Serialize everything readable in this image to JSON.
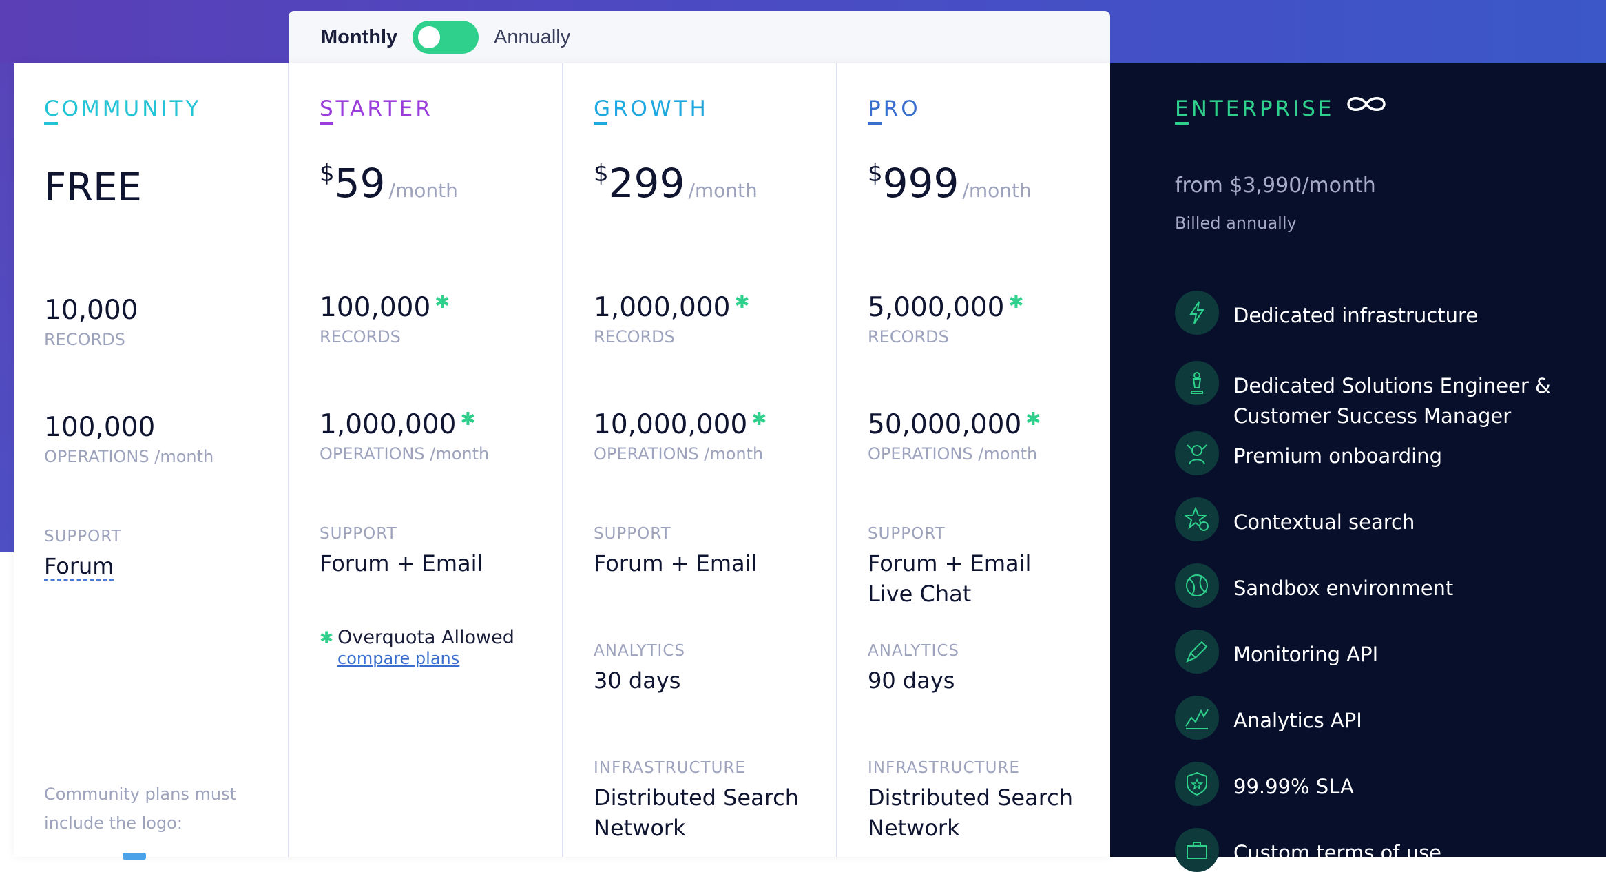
{
  "billing_toggle": {
    "monthly_label": "Monthly",
    "annually_label": "Annually",
    "state": "monthly"
  },
  "plans": [
    {
      "name": "COMMUNITY",
      "color": "#22c4d6",
      "price": "FREE",
      "records": "10,000",
      "records_label": "RECORDS",
      "operations": "100,000",
      "operations_label": "OPERATIONS /month",
      "support_head": "SUPPORT",
      "support": "Forum",
      "note": "Community plans must include the logo:"
    },
    {
      "name": "STARTER",
      "color": "#9b3ddb",
      "currency": "$",
      "amount": "59",
      "per": "/month",
      "records": "100,000",
      "records_label": "RECORDS",
      "operations": "1,000,000",
      "operations_label": "OPERATIONS /month",
      "support_head": "SUPPORT",
      "support": "Forum + Email",
      "overquota": "Overquota Allowed",
      "compare": "compare plans"
    },
    {
      "name": "GROWTH",
      "color": "#1fa8e0",
      "currency": "$",
      "amount": "299",
      "per": "/month",
      "records": "1,000,000",
      "records_label": "RECORDS",
      "operations": "10,000,000",
      "operations_label": "OPERATIONS /month",
      "support_head": "SUPPORT",
      "support": "Forum + Email",
      "analytics_head": "ANALYTICS",
      "analytics": "30 days",
      "infra_head": "INFRASTRUCTURE",
      "infra_line1": "Distributed Search",
      "infra_line2": "Network"
    },
    {
      "name": "PRO",
      "color": "#3a6fd0",
      "currency": "$",
      "amount": "999",
      "per": "/month",
      "records": "5,000,000",
      "records_label": "RECORDS",
      "operations": "50,000,000",
      "operations_label": "OPERATIONS /month",
      "support_head": "SUPPORT",
      "support_line1": "Forum + Email",
      "support_line2": "Live Chat",
      "analytics_head": "ANALYTICS",
      "analytics": "90 days",
      "infra_head": "INFRASTRUCTURE",
      "infra_line1": "Distributed Search",
      "infra_line2": "Network"
    }
  ],
  "enterprise": {
    "name": "ENTERPRISE",
    "price": "from $3,990/month",
    "billed": "Billed annually",
    "features": [
      {
        "icon": "lightning-icon",
        "line1": "Dedicated infrastructure"
      },
      {
        "icon": "chess-piece-icon",
        "line1": "Dedicated Solutions Engineer &",
        "line2": "Customer Success Manager"
      },
      {
        "icon": "viking-icon",
        "line1": "Premium onboarding"
      },
      {
        "icon": "star-user-icon",
        "line1": "Contextual search"
      },
      {
        "icon": "ball-icon",
        "line1": "Sandbox environment"
      },
      {
        "icon": "probe-icon",
        "line1": "Monitoring API"
      },
      {
        "icon": "chart-icon",
        "line1": "Analytics API"
      },
      {
        "icon": "shield-star-icon",
        "line1": "99.99% SLA"
      },
      {
        "icon": "briefcase-icon",
        "line1": "Custom terms of use"
      }
    ]
  }
}
